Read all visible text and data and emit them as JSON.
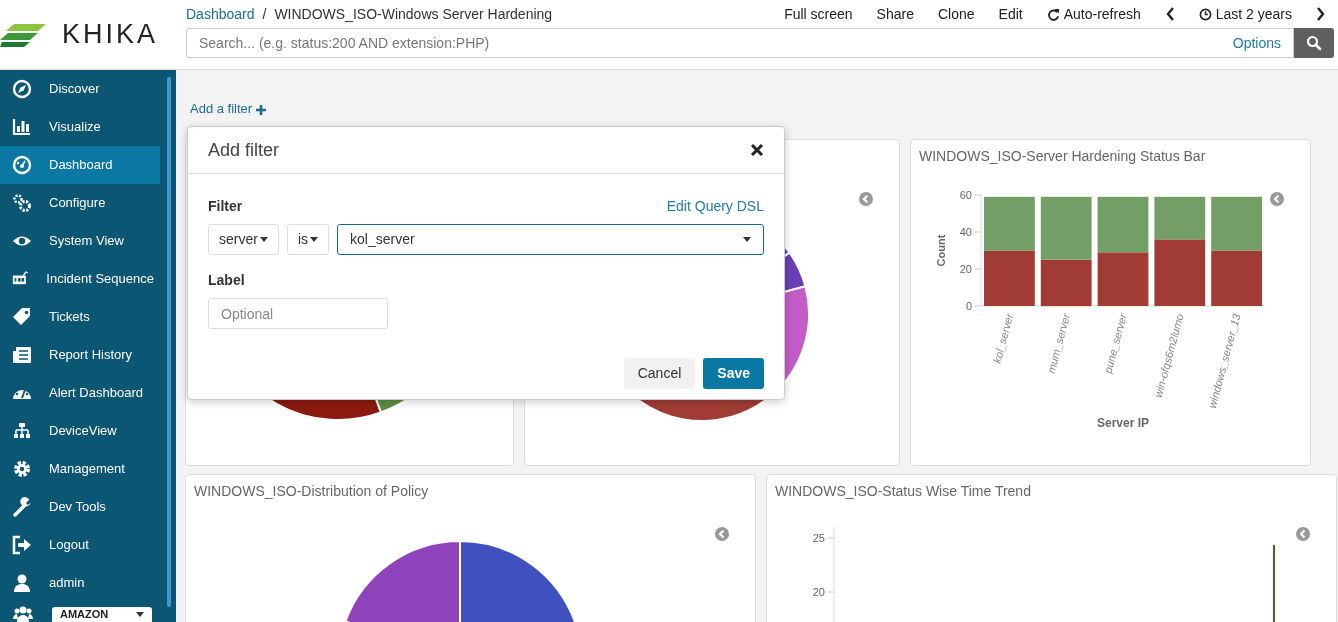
{
  "logo": {
    "text": "KHIKA"
  },
  "breadcrumb": {
    "parent": "Dashboard",
    "separator": "/",
    "current": "WINDOWS_ISO-Windows Server Hardening"
  },
  "top_menu": [
    {
      "kind": "text",
      "label": "Full screen"
    },
    {
      "kind": "text",
      "label": "Share"
    },
    {
      "kind": "text",
      "label": "Clone"
    },
    {
      "kind": "text",
      "label": "Edit"
    },
    {
      "kind": "refresh",
      "label": "Auto-refresh"
    },
    {
      "kind": "prev"
    },
    {
      "kind": "time",
      "label": "Last 2 years"
    },
    {
      "kind": "next"
    }
  ],
  "search": {
    "placeholder": "Search... (e.g. status:200 AND extension:PHP)",
    "options": "Options"
  },
  "sidebar": {
    "items": [
      {
        "label": "Discover",
        "selected": false
      },
      {
        "label": "Visualize",
        "selected": false
      },
      {
        "label": "Dashboard",
        "selected": true
      },
      {
        "label": "Configure",
        "selected": false
      },
      {
        "label": "System View",
        "selected": false
      },
      {
        "label": "Incident Sequence",
        "selected": false
      },
      {
        "label": "Tickets",
        "selected": false
      },
      {
        "label": "Report History",
        "selected": false
      },
      {
        "label": "Alert Dashboard",
        "selected": false
      },
      {
        "label": "DeviceView",
        "selected": false
      },
      {
        "label": "Management",
        "selected": false
      },
      {
        "label": "Dev Tools",
        "selected": false
      },
      {
        "label": "Logout",
        "selected": false
      },
      {
        "label": "admin",
        "selected": false
      }
    ],
    "tenant_select": {
      "value": "AMAZON"
    }
  },
  "add_filter": "Add a filter",
  "panels": [
    {
      "kind": "pie"
    },
    {
      "kind": "pie"
    },
    {
      "kind": "bar",
      "chart_data": {
        "type": "bar",
        "title": "WINDOWS_ISO-Server Hardening Status Bar",
        "xlabel": "Server IP",
        "ylabel": "Count",
        "categories": [
          "kol_server",
          "mum_server",
          "pune_server",
          "win-ofqs6m2lumo",
          "windows_server_13"
        ],
        "stacked": true,
        "ylim": [
          0,
          60
        ],
        "yticks": [
          0,
          20,
          40,
          60
        ],
        "series": [
          {
            "color": "#a03c34",
            "values": [
              30,
              25,
              29,
              36,
              30
            ]
          },
          {
            "color": "#739f67",
            "values": [
              29,
              34,
              30,
              23,
              29
            ]
          }
        ]
      }
    },
    {
      "kind": "pie",
      "title": "WINDOWS_ISO-Distribution of Policy"
    },
    {
      "kind": "line",
      "title": "WINDOWS_ISO-Status Wise Time Trend",
      "y_tick_labels": [
        "25",
        "20"
      ]
    }
  ],
  "modal": {
    "title": "Add filter",
    "filter_label": "Filter",
    "dsl_link": "Edit Query DSL",
    "field": "server",
    "operator": "is",
    "value": "kol_server",
    "label_label": "Label",
    "label_placeholder": "Optional",
    "buttons": [
      {
        "kind": "secondary",
        "label": "Cancel"
      },
      {
        "kind": "primary",
        "label": "Save"
      }
    ]
  }
}
